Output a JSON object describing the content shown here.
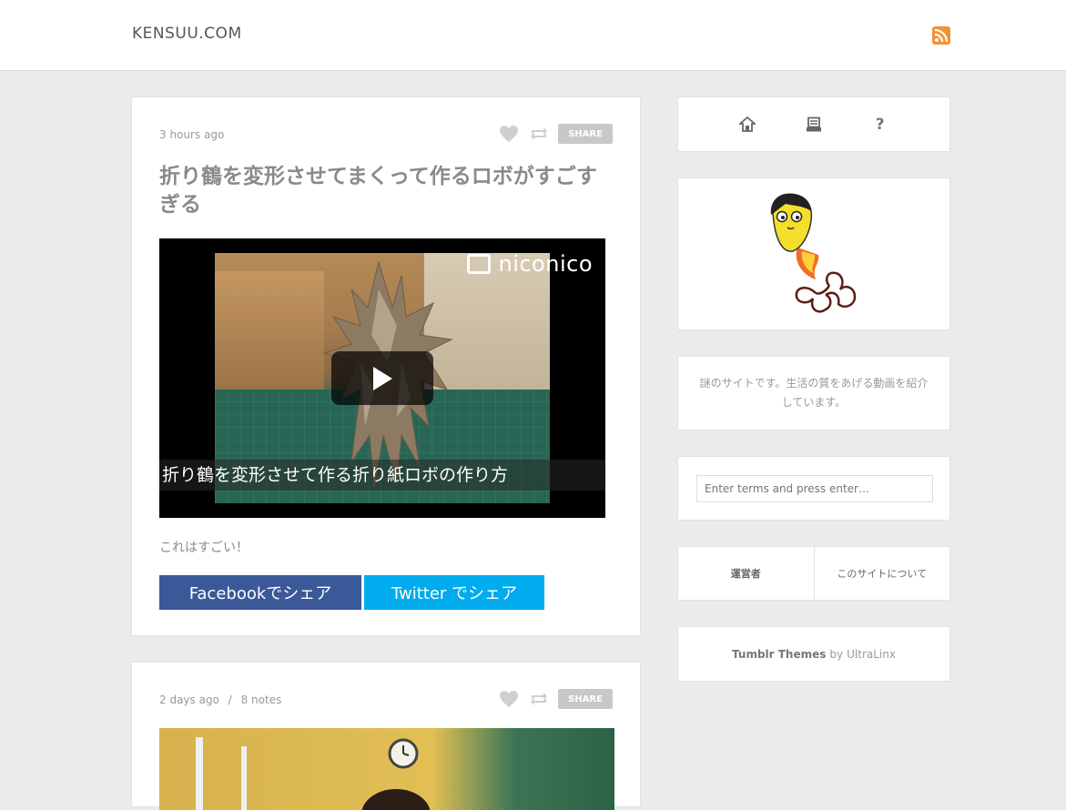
{
  "header": {
    "site_title": "KENSUU.COM"
  },
  "posts": [
    {
      "meta": "3 hours ago",
      "title": "折り鶴を変形させてまくって作るロボがすごすぎる",
      "video": {
        "brand": "niconico",
        "caption": "折り鶴を変形させて作る折り紙ロボの作り方"
      },
      "body": "これはすごい！",
      "share_label": "SHARE",
      "facebook_label": "Facebookでシェア",
      "twitter_label": "Twitter でシェア"
    },
    {
      "meta_time": "2 days ago",
      "meta_sep": "/",
      "meta_notes": "8 notes",
      "share_label": "SHARE"
    }
  ],
  "sidebar": {
    "nav_question": "?",
    "description": "謎のサイトです。生活の質をあげる動画を紹介しています。",
    "search_placeholder": "Enter terms and press enter…",
    "links": [
      "運営者",
      "このサイトについて"
    ],
    "credit_strong": "Tumblr Themes",
    "credit_by": "by",
    "credit_author": "UltraLinx"
  },
  "colors": {
    "facebook": "#3b5998",
    "twitter": "#00aced",
    "rss": "#f29230"
  }
}
